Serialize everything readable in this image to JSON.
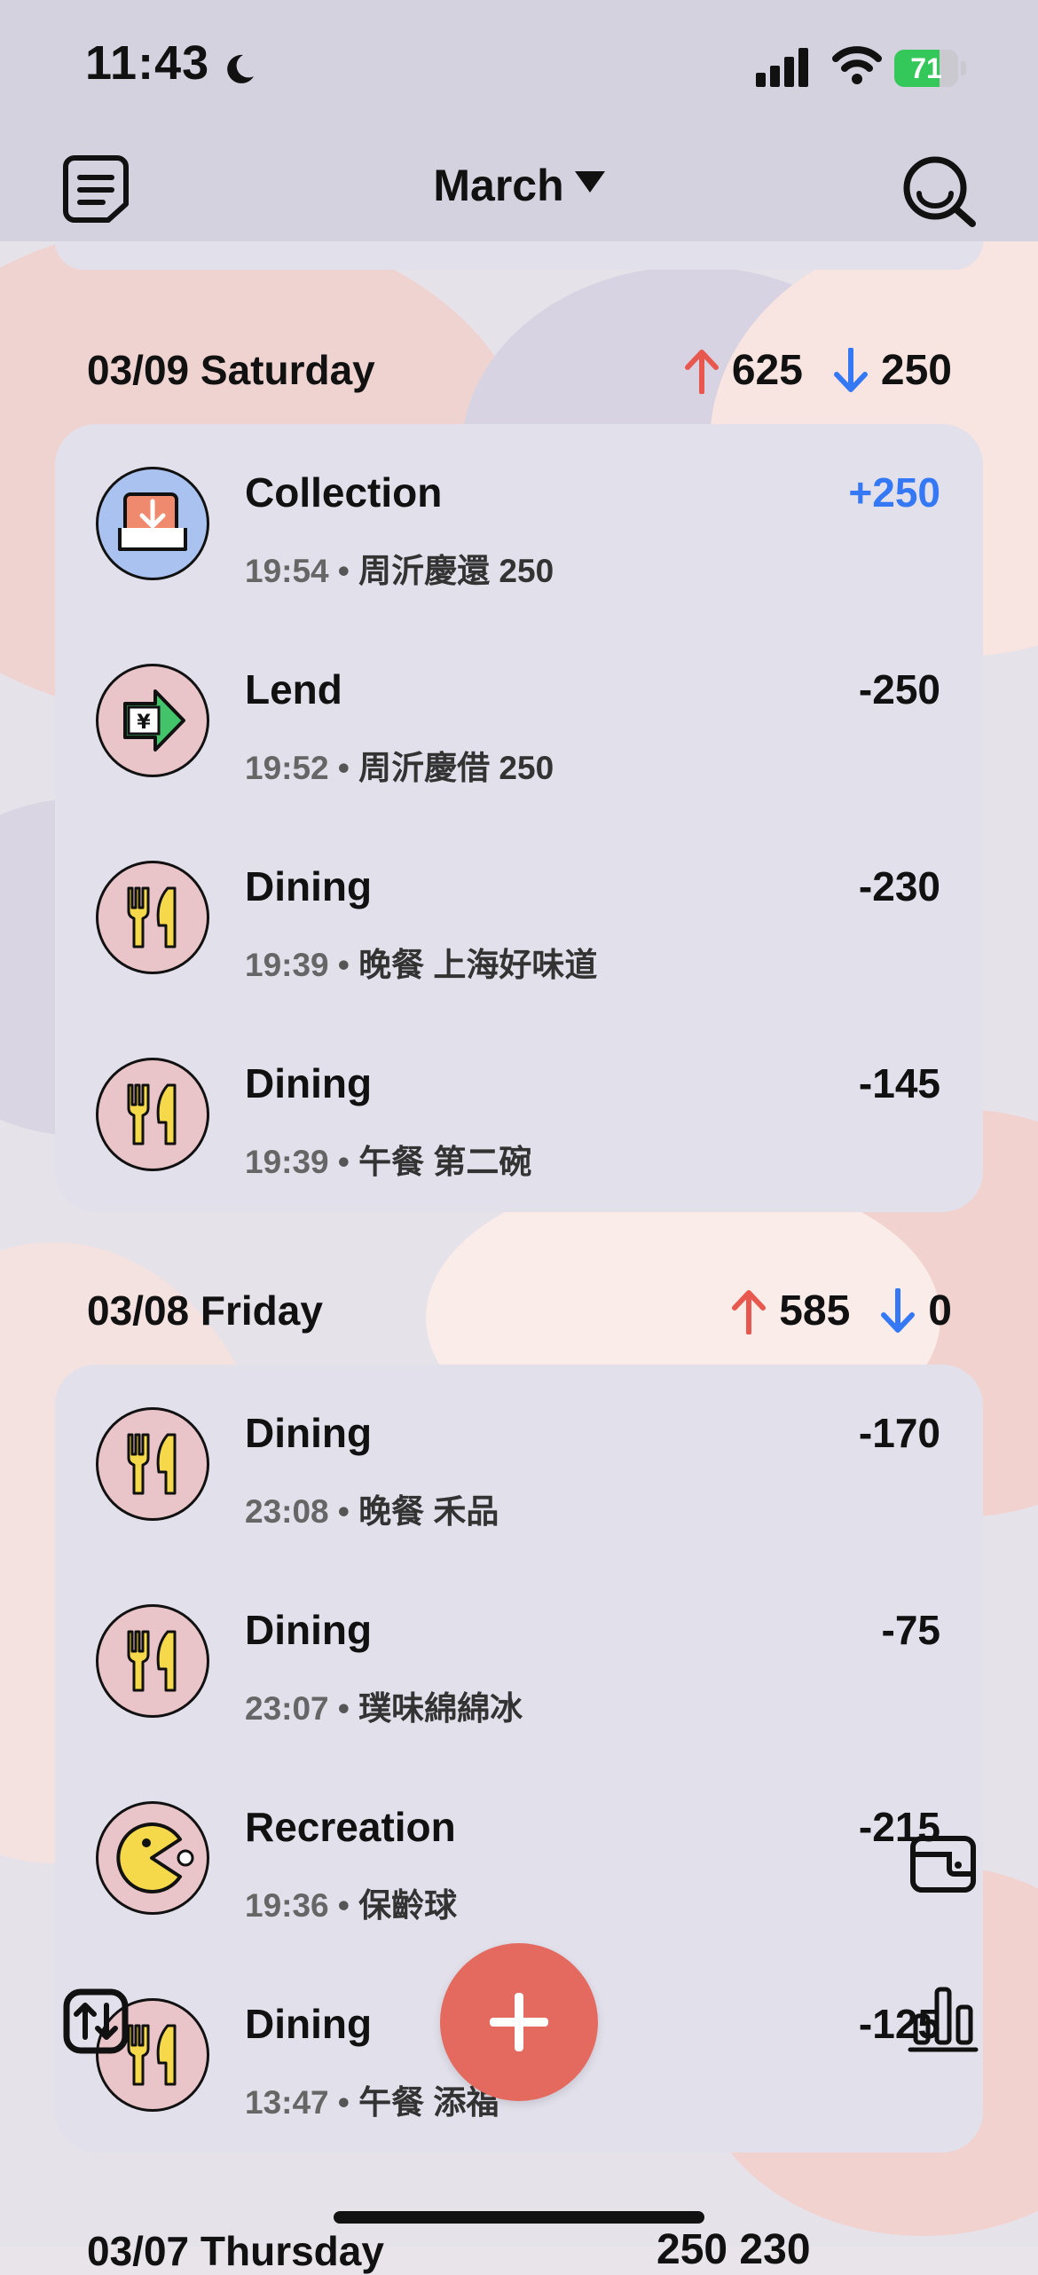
{
  "status_bar": {
    "time": "11:43",
    "battery": "71"
  },
  "header": {
    "month": "March"
  },
  "days": [
    {
      "label": "03/09 Saturday",
      "income": "625",
      "expense": "250",
      "transactions": [
        {
          "category": "Collection",
          "time": "19:54",
          "note": "周沂慶還 250",
          "amount": "+250",
          "icon": "collection-icon"
        },
        {
          "category": "Lend",
          "time": "19:52",
          "note": "周沂慶借 250",
          "amount": "-250",
          "icon": "lend-icon"
        },
        {
          "category": "Dining",
          "time": "19:39",
          "note": "晚餐 上海好味道",
          "amount": "-230",
          "icon": "dining-icon"
        },
        {
          "category": "Dining",
          "time": "19:39",
          "note": "午餐 第二碗",
          "amount": "-145",
          "icon": "dining-icon"
        }
      ]
    },
    {
      "label": "03/08 Friday",
      "income": "585",
      "expense": "0",
      "transactions": [
        {
          "category": "Dining",
          "time": "23:08",
          "note": "晚餐 禾品",
          "amount": "-170",
          "icon": "dining-icon"
        },
        {
          "category": "Dining",
          "time": "23:07",
          "note": "璞味綿綿冰",
          "amount": "-75",
          "icon": "dining-icon"
        },
        {
          "category": "Recreation",
          "time": "19:36",
          "note": "保齡球",
          "amount": "-215",
          "icon": "recreation-icon"
        },
        {
          "category": "Dining",
          "time": "13:47",
          "note": "午餐 添福",
          "amount": "-125",
          "icon": "dining-icon"
        }
      ]
    }
  ],
  "next_day_peek": {
    "label": "03/07 Thursday",
    "totals": "250  230"
  },
  "colors": {
    "income_arrow": "#e8584f",
    "expense_arrow": "#3478f6",
    "fab": "#e46a5f",
    "positive_amount": "#3478f6"
  }
}
